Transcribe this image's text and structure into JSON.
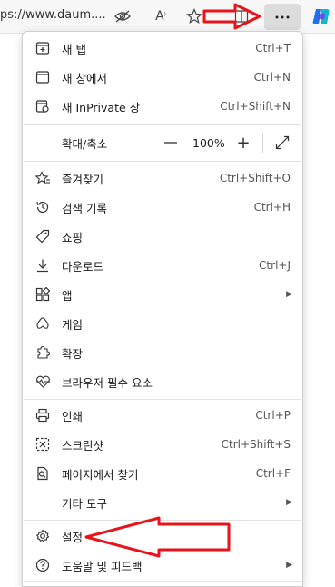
{
  "toolbar": {
    "url_text": "ps://www.daum....",
    "icons": [
      "eye-off-icon",
      "read-aloud-icon",
      "favorite-star-icon",
      "split-screen-icon",
      "more-icon",
      "copilot-icon"
    ]
  },
  "menu": {
    "new_tab": {
      "label": "새 탭",
      "shortcut": "Ctrl+T"
    },
    "new_window": {
      "label": "새 창에서",
      "shortcut": "Ctrl+N"
    },
    "new_inprivate": {
      "label": "새 InPrivate 창",
      "shortcut": "Ctrl+Shift+N"
    },
    "zoom": {
      "label": "확대/축소",
      "minus": "—",
      "value": "100%",
      "plus": "+"
    },
    "favorites": {
      "label": "즐겨찾기",
      "shortcut": "Ctrl+Shift+O"
    },
    "history": {
      "label": "검색 기록",
      "shortcut": "Ctrl+H"
    },
    "shopping": {
      "label": "쇼핑"
    },
    "downloads": {
      "label": "다운로드",
      "shortcut": "Ctrl+J"
    },
    "apps": {
      "label": "앱",
      "arrow": "▶"
    },
    "games": {
      "label": "게임"
    },
    "extensions": {
      "label": "확장"
    },
    "essentials": {
      "label": "브라우저 필수 요소"
    },
    "print": {
      "label": "인쇄",
      "shortcut": "Ctrl+P"
    },
    "screenshot": {
      "label": "스크린샷",
      "shortcut": "Ctrl+Shift+S"
    },
    "find": {
      "label": "페이지에서 찾기",
      "shortcut": "Ctrl+F"
    },
    "more_tools": {
      "label": "기타 도구",
      "arrow": "▶"
    },
    "settings": {
      "label": "설정"
    },
    "help": {
      "label": "도움말 및 피드백",
      "arrow": "▶"
    }
  },
  "colors": {
    "annotation_arrow": "#e8131b",
    "menu_bg": "#ffffff",
    "hover_bg": "#dcdcdc"
  }
}
